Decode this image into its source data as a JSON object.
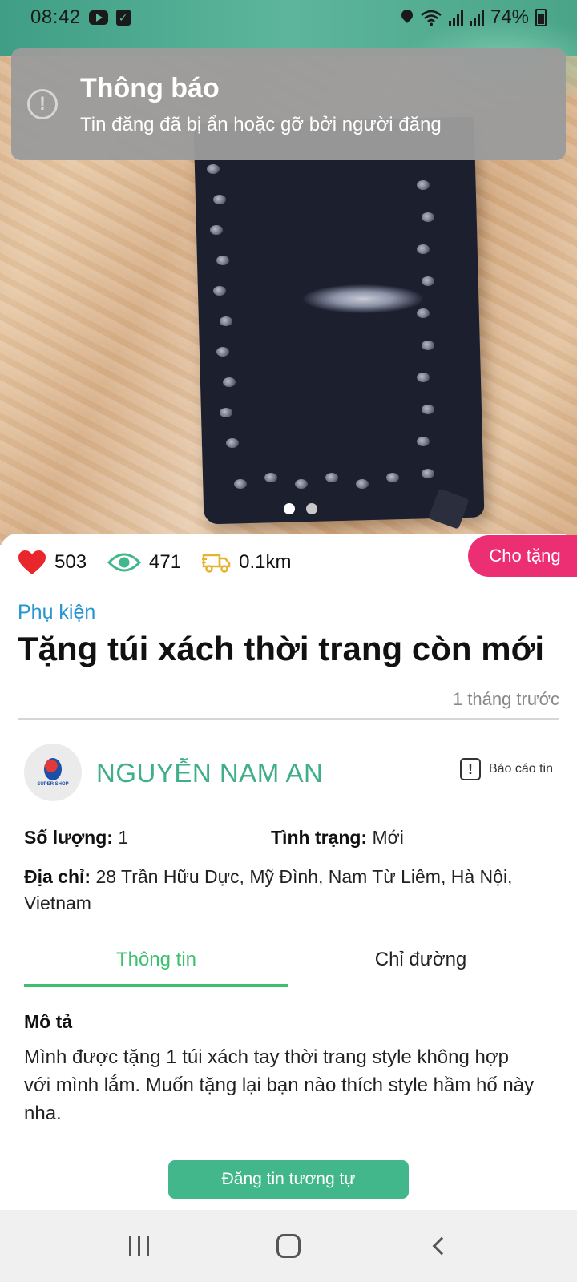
{
  "status_bar": {
    "time": "08:42",
    "battery": "74%",
    "icons": [
      "youtube-icon",
      "checkbox-icon",
      "location-icon",
      "wifi-icon",
      "signal-icon",
      "signal-icon",
      "battery-icon"
    ]
  },
  "toast": {
    "title": "Thông báo",
    "message": "Tin đăng đã bị ẩn hoặc gỡ bởi người đăng",
    "icon": "exclamation-circle-icon"
  },
  "carousel": {
    "count": 2,
    "active_index": 0
  },
  "stats": {
    "likes": "503",
    "views": "471",
    "distance": "0.1km",
    "like_color": "#e8262c",
    "view_color": "#42b78b",
    "truck_color": "#e6b32f"
  },
  "badge": {
    "label": "Cho tặng",
    "color": "#ec2f72"
  },
  "post": {
    "category": "Phụ kiện",
    "title": "Tặng túi xách thời trang còn mới",
    "time_ago": "1 tháng trước"
  },
  "seller": {
    "name": "NGUYỄN NAM AN",
    "avatar_logo_text": "SUPER SHOP",
    "report_label": "Báo cáo tin"
  },
  "details": {
    "quantity_label": "Số lượng:",
    "quantity_value": "1",
    "condition_label": "Tình trạng:",
    "condition_value": "Mới",
    "address_label": "Địa chỉ:",
    "address_value": "28 Trần Hữu Dực, Mỹ Đình, Nam Từ Liêm, Hà Nội, Vietnam"
  },
  "tabs": [
    {
      "label": "Thông tin",
      "active": true
    },
    {
      "label": "Chỉ đường",
      "active": false
    }
  ],
  "description": {
    "heading": "Mô tả",
    "text": "Mình được tặng 1 túi xách tay thời trang style không hợp với mình lắm. Muốn tặng lại bạn nào thích style hầm hố này nha."
  },
  "cta": {
    "label": "Đăng tin tương tự",
    "color": "#42b78b"
  },
  "navbar": {
    "buttons": [
      "recents-icon",
      "home-icon",
      "back-icon"
    ]
  }
}
